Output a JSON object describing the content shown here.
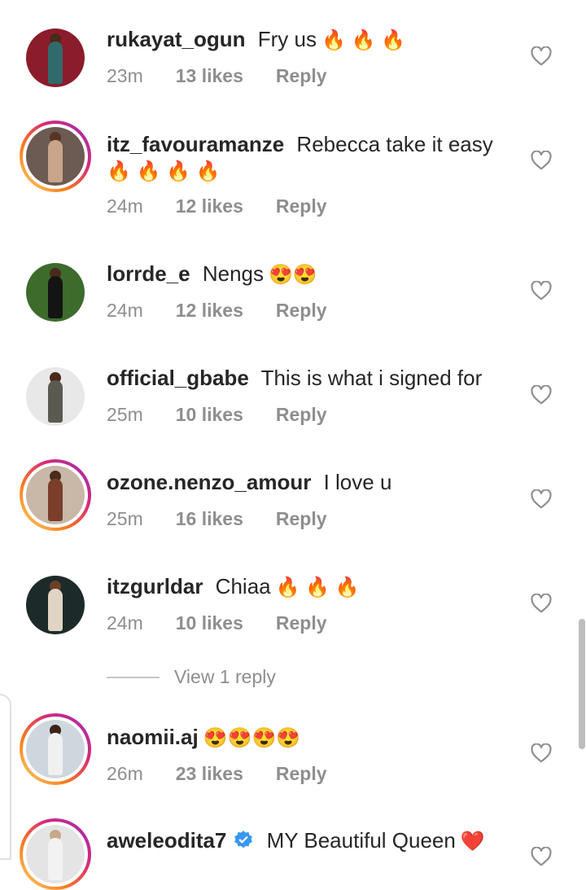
{
  "comments": [
    {
      "username": "rukayat_ogun",
      "text": "Fry us",
      "emojis": "🔥 🔥 🔥",
      "time": "23m",
      "likes": "13 likes",
      "reply": "Reply",
      "ring": false,
      "bg": "#8b1c2b",
      "fig": "#2f6b6b",
      "skin": "#4a2a1a"
    },
    {
      "username": "itz_favouramanze",
      "text": "Rebecca take it easy",
      "emojis": "🔥 🔥 🔥 🔥",
      "time": "24m",
      "likes": "12 likes",
      "reply": "Reply",
      "ring": true,
      "bg": "#6b5b52",
      "fig": "#c8a48b",
      "skin": "#5a3422"
    },
    {
      "username": "lorrde_e",
      "text": "Nengs",
      "emojis": "😍😍",
      "time": "24m",
      "likes": "12 likes",
      "reply": "Reply",
      "ring": false,
      "bg": "#3d6b2c",
      "fig": "#141414",
      "skin": "#4a2a1a"
    },
    {
      "username": "official_gbabe",
      "text": "This is what i signed for",
      "emojis": "",
      "time": "25m",
      "likes": "10 likes",
      "reply": "Reply",
      "ring": false,
      "bg": "#e8e8e8",
      "fig": "#5a5a52",
      "skin": "#4a2a1a"
    },
    {
      "username": "ozone.nenzo_amour",
      "text": "I love u",
      "emojis": "",
      "time": "25m",
      "likes": "16 likes",
      "reply": "Reply",
      "ring": true,
      "bg": "#c9b7a8",
      "fig": "#7a3e2a",
      "skin": "#4a2a1a"
    },
    {
      "username": "itzgurldar",
      "text": "Chiaa",
      "emojis": "🔥 🔥 🔥",
      "time": "24m",
      "likes": "10 likes",
      "reply": "Reply",
      "ring": false,
      "bg": "#1d2a2a",
      "fig": "#e0d4c4",
      "skin": "#6a4028"
    },
    {
      "username": "naomii.aj",
      "text": "",
      "emojis": "😍😍😍😍",
      "time": "26m",
      "likes": "23 likes",
      "reply": "Reply",
      "ring": true,
      "bg": "#cfd7de",
      "fig": "#f0f0f0",
      "skin": "#3a2418"
    },
    {
      "username": "aweleodita7",
      "text": "MY Beautiful Queen",
      "emojis": "❤️",
      "time": "",
      "likes": "",
      "reply": "",
      "ring": true,
      "bg": "#e4e4e4",
      "fig": "#f2f2f2",
      "skin": "#c7a98a",
      "verified": true
    }
  ],
  "view_replies": "View 1 reply",
  "icons": {
    "like": "heart-outline-icon",
    "verified": "verified-badge-icon"
  },
  "colors": {
    "text": "#262626",
    "meta": "#8e8e8e",
    "accent": "#3897f0"
  }
}
